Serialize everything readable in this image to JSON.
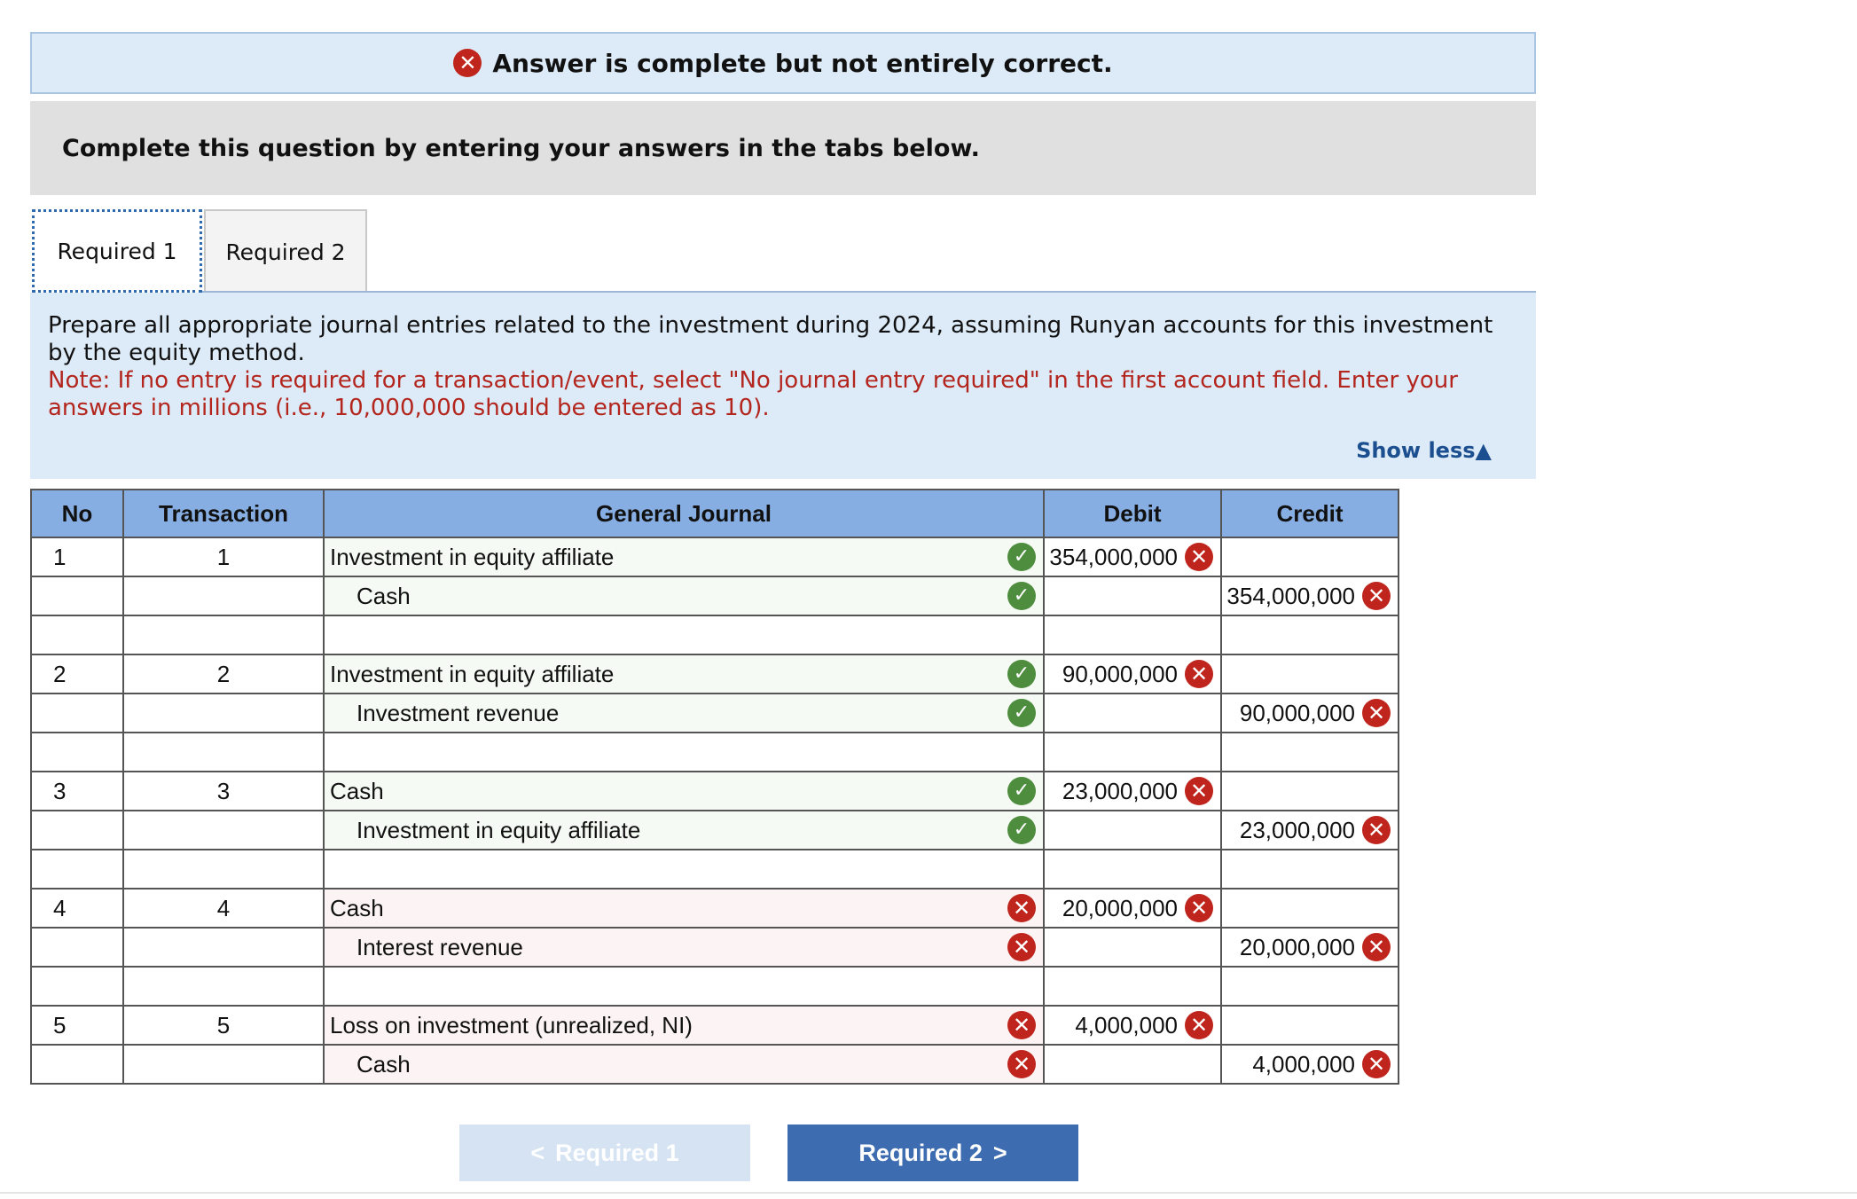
{
  "banner": {
    "text": "Answer is complete but not entirely correct."
  },
  "instruction": "Complete this question by entering your answers in the tabs below.",
  "tabs": [
    {
      "label": "Required 1"
    },
    {
      "label": "Required 2"
    }
  ],
  "prompt": {
    "text": "Prepare all appropriate journal entries related to the investment during 2024, assuming Runyan accounts for this investment by the equity method.",
    "note": "Note: If no entry is required for a transaction/event, select \"No journal entry required\" in the first account field. Enter your answers in millions (i.e., 10,000,000 should be entered as 10).",
    "show_less": "Show less"
  },
  "table": {
    "headers": {
      "no": "No",
      "transaction": "Transaction",
      "journal": "General Journal",
      "debit": "Debit",
      "credit": "Credit"
    },
    "rows": [
      {
        "no": "1",
        "transaction": "1",
        "account": "Investment in equity affiliate",
        "account_status": "correct",
        "debit": "354,000,000",
        "debit_status": "incorrect",
        "credit": "",
        "credit_status": ""
      },
      {
        "no": "",
        "transaction": "",
        "account": "Cash",
        "account_status": "correct",
        "debit": "",
        "debit_status": "",
        "credit": "354,000,000",
        "credit_status": "incorrect"
      },
      {
        "no": "",
        "transaction": "",
        "account": "",
        "account_status": "",
        "debit": "",
        "debit_status": "",
        "credit": "",
        "credit_status": ""
      },
      {
        "no": "2",
        "transaction": "2",
        "account": "Investment in equity affiliate",
        "account_status": "correct",
        "debit": "90,000,000",
        "debit_status": "incorrect",
        "credit": "",
        "credit_status": ""
      },
      {
        "no": "",
        "transaction": "",
        "account": "Investment revenue",
        "account_status": "correct",
        "debit": "",
        "debit_status": "",
        "credit": "90,000,000",
        "credit_status": "incorrect"
      },
      {
        "no": "",
        "transaction": "",
        "account": "",
        "account_status": "",
        "debit": "",
        "debit_status": "",
        "credit": "",
        "credit_status": ""
      },
      {
        "no": "3",
        "transaction": "3",
        "account": "Cash",
        "account_status": "correct",
        "debit": "23,000,000",
        "debit_status": "incorrect",
        "credit": "",
        "credit_status": ""
      },
      {
        "no": "",
        "transaction": "",
        "account": "Investment in equity affiliate",
        "account_status": "correct",
        "debit": "",
        "debit_status": "",
        "credit": "23,000,000",
        "credit_status": "incorrect"
      },
      {
        "no": "",
        "transaction": "",
        "account": "",
        "account_status": "",
        "debit": "",
        "debit_status": "",
        "credit": "",
        "credit_status": ""
      },
      {
        "no": "4",
        "transaction": "4",
        "account": "Cash",
        "account_status": "incorrect",
        "debit": "20,000,000",
        "debit_status": "incorrect",
        "credit": "",
        "credit_status": ""
      },
      {
        "no": "",
        "transaction": "",
        "account": "Interest revenue",
        "account_status": "incorrect",
        "debit": "",
        "debit_status": "",
        "credit": "20,000,000",
        "credit_status": "incorrect"
      },
      {
        "no": "",
        "transaction": "",
        "account": "",
        "account_status": "",
        "debit": "",
        "debit_status": "",
        "credit": "",
        "credit_status": ""
      },
      {
        "no": "5",
        "transaction": "5",
        "account": "Loss on investment (unrealized, NI)",
        "account_status": "incorrect",
        "debit": "4,000,000",
        "debit_status": "incorrect",
        "credit": "",
        "credit_status": ""
      },
      {
        "no": "",
        "transaction": "",
        "account": "Cash",
        "account_status": "incorrect",
        "debit": "",
        "debit_status": "",
        "credit": "4,000,000",
        "credit_status": "incorrect"
      }
    ]
  },
  "nav": {
    "prev_label": "Required 1",
    "next_label": "Required 2"
  },
  "icons": {
    "correct": "check-circle-icon",
    "incorrect": "x-circle-icon",
    "prev": "chevron-left-icon",
    "next": "chevron-right-icon",
    "collapse": "triangle-up-icon"
  },
  "colors": {
    "correct": "#4e8d3e",
    "incorrect": "#c0251d",
    "header": "#86aee2",
    "primary_button": "#3e6cb0"
  }
}
